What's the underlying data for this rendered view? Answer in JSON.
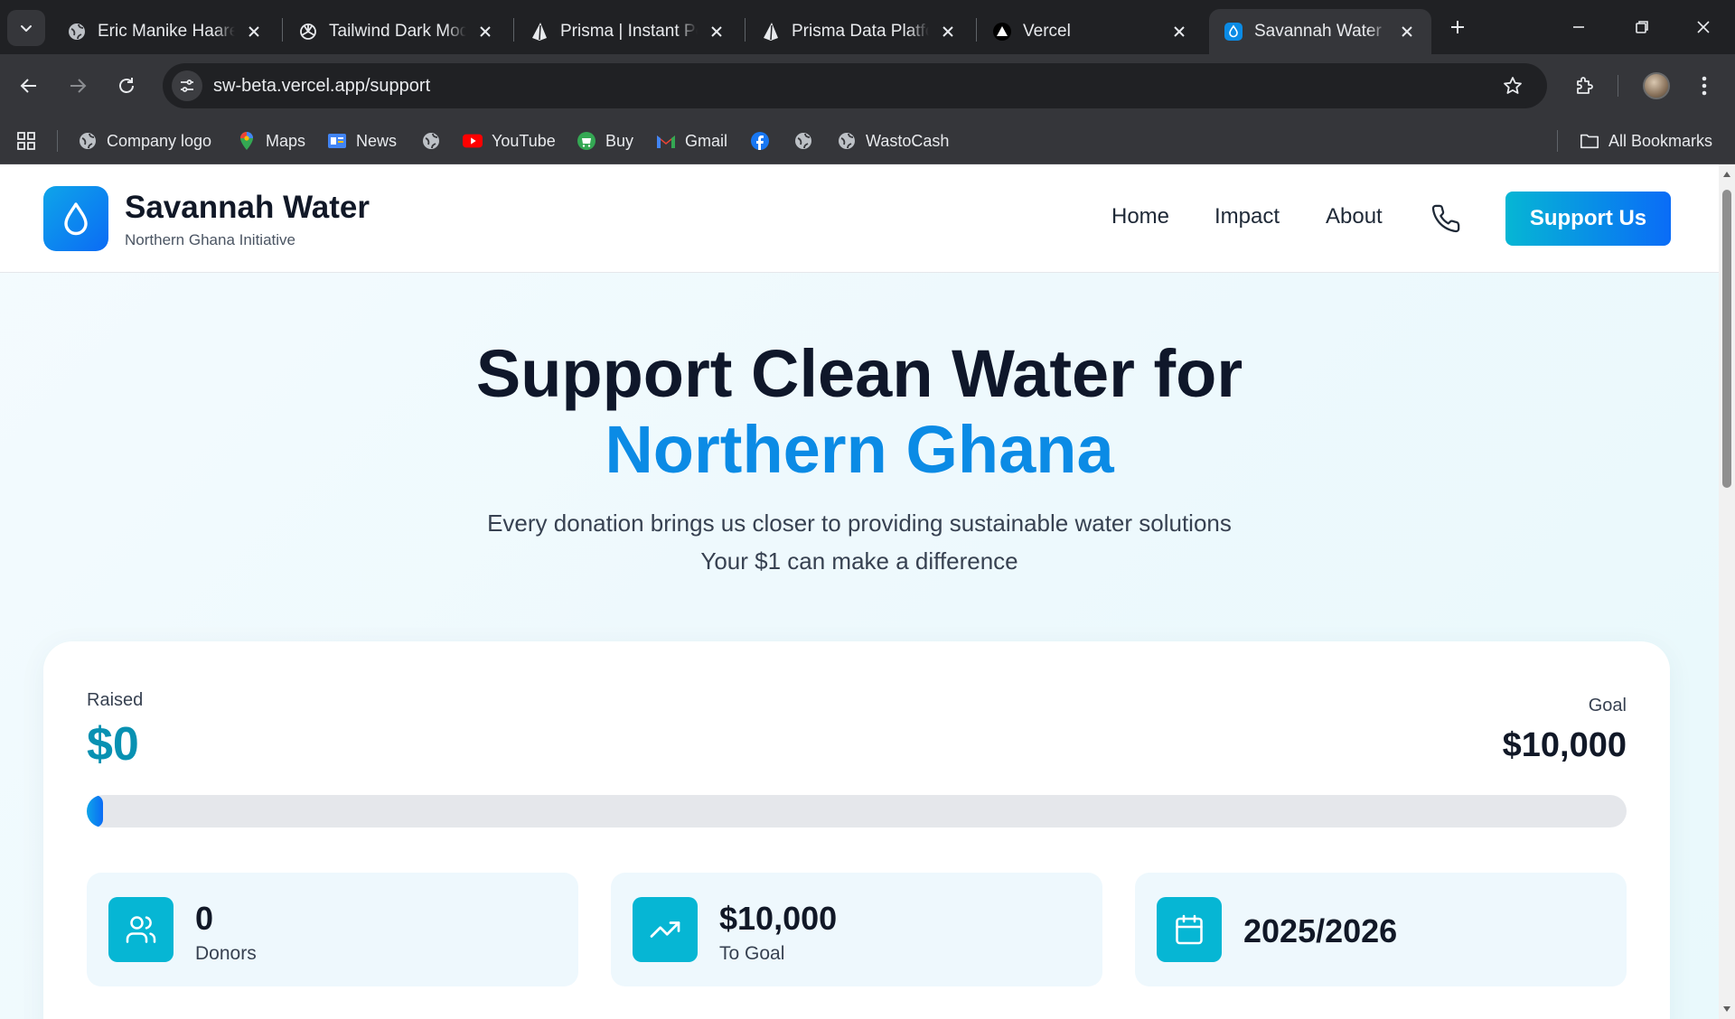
{
  "browser": {
    "tabs": [
      {
        "title": "Eric Manike Haare",
        "icon": "globe-icon"
      },
      {
        "title": "Tailwind Dark Mod",
        "icon": "openai-icon"
      },
      {
        "title": "Prisma | Instant Po",
        "icon": "prisma-icon"
      },
      {
        "title": "Prisma Data Platfo",
        "icon": "prisma-icon"
      },
      {
        "title": "Vercel",
        "icon": "vercel-icon"
      },
      {
        "title": "Savannah Water",
        "icon": "water-drop-icon",
        "active": true
      }
    ],
    "url": "sw-beta.vercel.app/support",
    "bookmarks": [
      {
        "label": "Company logo",
        "icon": "globe-icon"
      },
      {
        "label": "Maps",
        "icon": "maps-icon"
      },
      {
        "label": "News",
        "icon": "news-icon"
      },
      {
        "label": "",
        "icon": "globe-icon"
      },
      {
        "label": "YouTube",
        "icon": "youtube-icon"
      },
      {
        "label": "Buy",
        "icon": "buy-icon"
      },
      {
        "label": "Gmail",
        "icon": "gmail-icon"
      },
      {
        "label": "",
        "icon": "facebook-icon"
      },
      {
        "label": "",
        "icon": "globe-icon"
      },
      {
        "label": "WastoCash",
        "icon": "globe-icon"
      }
    ],
    "all_bookmarks_label": "All Bookmarks"
  },
  "site": {
    "brand_name": "Savannah Water",
    "brand_subtitle": "Northern Ghana Initiative",
    "nav": [
      "Home",
      "Impact",
      "About"
    ],
    "cta_label": "Support Us",
    "accent_color": "#0b8be5",
    "brand_gradient": [
      "#06b6d4",
      "#0a6cf7"
    ]
  },
  "hero": {
    "title_line1": "Support Clean Water for",
    "title_line2": "Northern Ghana",
    "subtitle_line1": "Every donation brings us closer to providing sustainable water solutions",
    "subtitle_line2": "Your $1 can make a difference"
  },
  "progress": {
    "raised_label": "Raised",
    "raised_value": "$0",
    "goal_label": "Goal",
    "goal_value": "$10,000",
    "percent_complete": 0
  },
  "stats": [
    {
      "value": "0",
      "label": "Donors",
      "icon": "users-icon"
    },
    {
      "value": "$10,000",
      "label": "To Goal",
      "icon": "trending-up-icon"
    },
    {
      "value": "2025/2026",
      "label": "",
      "icon": "calendar-icon"
    }
  ]
}
